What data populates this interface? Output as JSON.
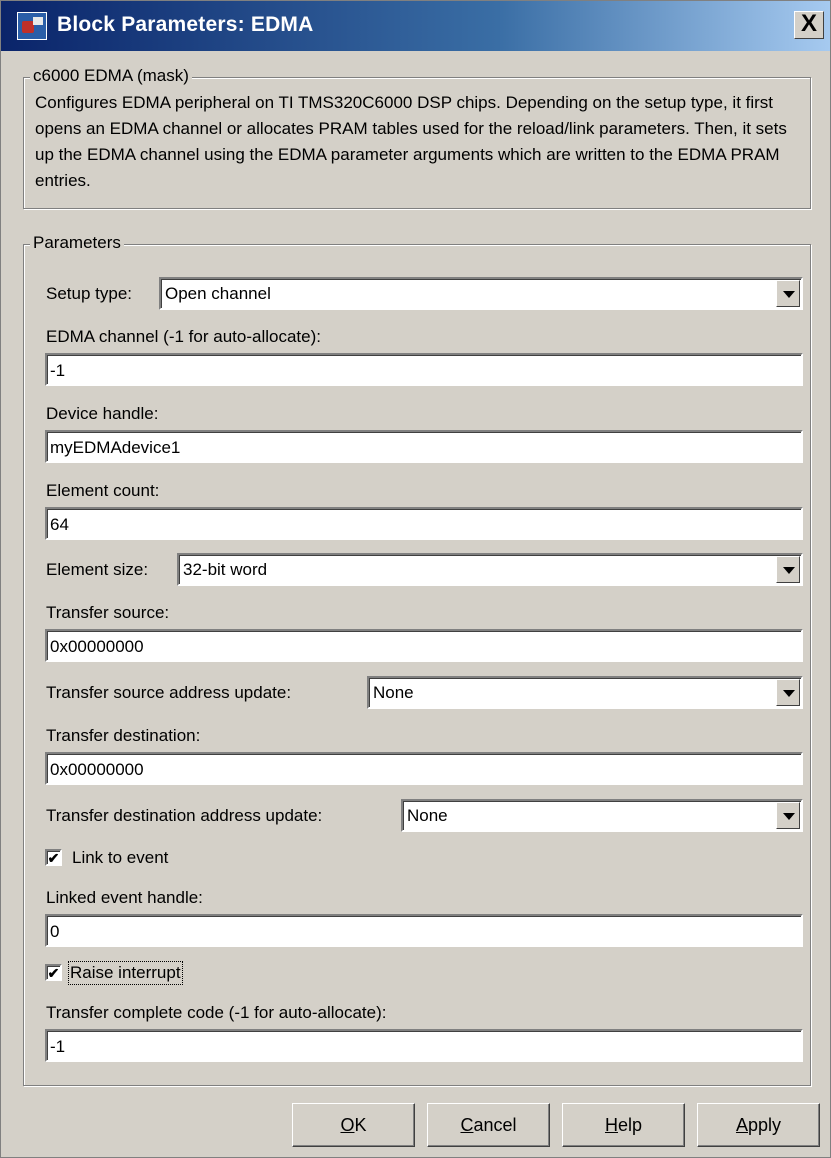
{
  "window": {
    "title": "Block Parameters: EDMA",
    "close_glyph": "✕",
    "close_label": "X"
  },
  "mask": {
    "legend": "c6000 EDMA (mask)",
    "description": "Configures EDMA peripheral on TI TMS320C6000 DSP chips.  Depending on the setup type, it first opens an EDMA channel or allocates PRAM tables used for the reload/link parameters. Then, it sets up the EDMA channel using the EDMA parameter arguments which are written to the EDMA PRAM entries."
  },
  "params": {
    "legend": "Parameters",
    "setup_type": {
      "label": "Setup type:",
      "value": "Open channel"
    },
    "edma_channel": {
      "label": "EDMA channel (-1 for auto-allocate):",
      "value": "-1"
    },
    "device_handle": {
      "label": "Device handle:",
      "value": "myEDMAdevice1"
    },
    "element_count": {
      "label": "Element count:",
      "value": "64"
    },
    "element_size": {
      "label": "Element size:",
      "value": "32-bit word"
    },
    "transfer_source": {
      "label": "Transfer source:",
      "value": "0x00000000"
    },
    "source_update": {
      "label": "Transfer source address update:",
      "value": "None"
    },
    "transfer_destination": {
      "label": "Transfer destination:",
      "value": "0x00000000"
    },
    "destination_update": {
      "label": "Transfer destination address update:",
      "value": "None"
    },
    "link_to_event": {
      "label": "Link to event",
      "checked": true
    },
    "linked_event_handle": {
      "label": "Linked event handle:",
      "value": "0"
    },
    "raise_interrupt": {
      "label": "Raise interrupt",
      "checked": true
    },
    "transfer_complete_code": {
      "label": "Transfer complete code (-1 for auto-allocate):",
      "value": "-1"
    }
  },
  "buttons": {
    "ok": {
      "mnemonic": "O",
      "rest": "K"
    },
    "cancel": {
      "mnemonic": "C",
      "rest": "ancel"
    },
    "help": {
      "mnemonic": "H",
      "rest": "elp"
    },
    "apply": {
      "mnemonic": "A",
      "rest": "pply"
    }
  },
  "colors": {
    "dialog_bg": "#d4d0c8",
    "title_start": "#0a246a",
    "title_end": "#a6caf0"
  },
  "icons": {
    "app": "simulink-block-icon",
    "check": "✔"
  }
}
